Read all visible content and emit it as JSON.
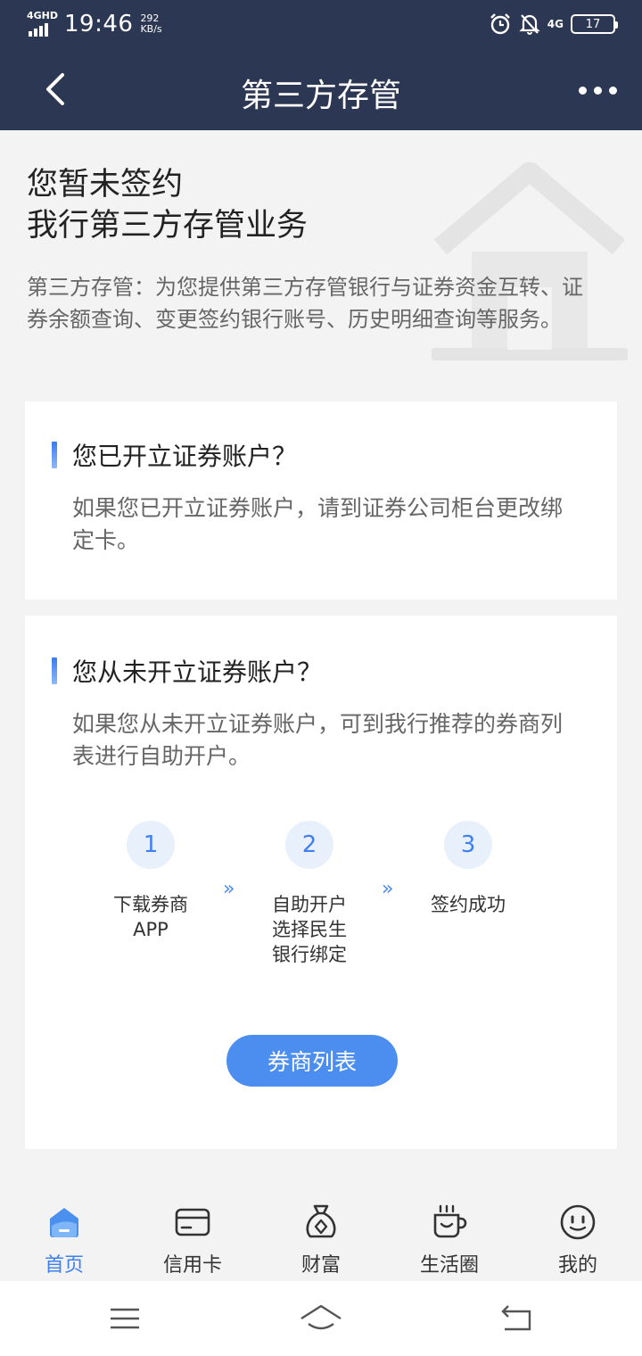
{
  "status": {
    "network": "4GHD",
    "time": "19:46",
    "speed_value": "292",
    "speed_unit": "KB/s",
    "net_type": "4G",
    "battery": "17"
  },
  "nav": {
    "title": "第三方存管",
    "back_icon": "chevron-left-icon",
    "more_icon": "more-dots-icon"
  },
  "intro": {
    "title_line1": "您暂未签约",
    "title_line2": "我行第三方存管业务",
    "description": "第三方存管：为您提供第三方存管银行与证券资金互转、证券余额查询、变更签约银行账号、历史明细查询等服务。"
  },
  "card_opened": {
    "heading": "您已开立证券账户？",
    "body": "如果您已开立证券账户，请到证券公司柜台更改绑定卡。"
  },
  "card_not_opened": {
    "heading": "您从未开立证券账户？",
    "body": "如果您从未开立证券账户，可到我行推荐的券商列表进行自助开户。",
    "steps": [
      {
        "number": "1",
        "label_line1": "下载券商",
        "label_line2": "APP",
        "label_line3": ""
      },
      {
        "number": "2",
        "label_line1": "自助开户",
        "label_line2": "选择民生",
        "label_line3": "银行绑定"
      },
      {
        "number": "3",
        "label_line1": "签约成功",
        "label_line2": "",
        "label_line3": ""
      }
    ],
    "arrow": "»",
    "button_label": "券商列表"
  },
  "tabbar": {
    "items": [
      {
        "label": "首页",
        "icon": "home-icon",
        "active": true
      },
      {
        "label": "信用卡",
        "icon": "credit-card-icon",
        "active": false
      },
      {
        "label": "财富",
        "icon": "wealth-bag-icon",
        "active": false
      },
      {
        "label": "生活圈",
        "icon": "coffee-cup-icon",
        "active": false
      },
      {
        "label": "我的",
        "icon": "smiley-face-icon",
        "active": false
      }
    ]
  },
  "system_nav": {
    "menu_icon": "menu-icon",
    "home_icon": "system-home-icon",
    "back_icon": "system-back-icon"
  },
  "colors": {
    "header_bg": "#2c3753",
    "accent": "#4c8ef0",
    "active_tab": "#3f80ee"
  }
}
